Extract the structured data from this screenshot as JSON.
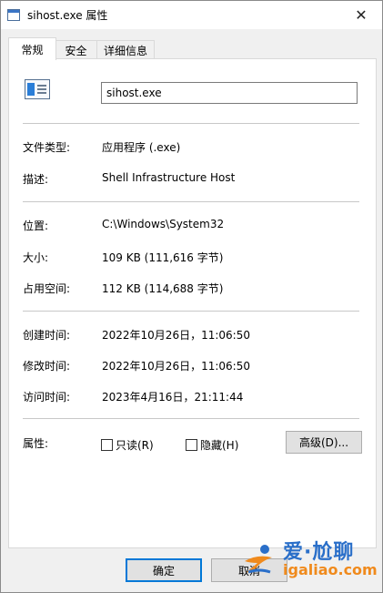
{
  "window": {
    "title": "sihost.exe 属性"
  },
  "tabs": [
    {
      "label": "常规"
    },
    {
      "label": "安全"
    },
    {
      "label": "详细信息"
    }
  ],
  "general": {
    "file_name": "sihost.exe",
    "file_type_label": "文件类型:",
    "file_type_value": "应用程序 (.exe)",
    "description_label": "描述:",
    "description_value": "Shell Infrastructure Host",
    "location_label": "位置:",
    "location_value": "C:\\Windows\\System32",
    "size_label": "大小:",
    "size_value": "109 KB (111,616 字节)",
    "size_on_disk_label": "占用空间:",
    "size_on_disk_value": "112 KB (114,688 字节)",
    "created_label": "创建时间:",
    "created_value": "2022年10月26日，11:06:50",
    "modified_label": "修改时间:",
    "modified_value": "2022年10月26日，11:06:50",
    "accessed_label": "访问时间:",
    "accessed_value": "2023年4月16日，21:11:44",
    "attributes_label": "属性:",
    "readonly_label": "只读(R)",
    "hidden_label": "隐藏(H)",
    "advanced_label": "高级(D)..."
  },
  "footer": {
    "ok_label": "确定",
    "cancel_label": "取消"
  },
  "watermark": {
    "line1": "爱·尬聊",
    "line2": "igaliao.com"
  },
  "colors": {
    "accent": "#0078d7",
    "watermark_blue": "#2a6fc9",
    "watermark_orange": "#f08a1c"
  }
}
